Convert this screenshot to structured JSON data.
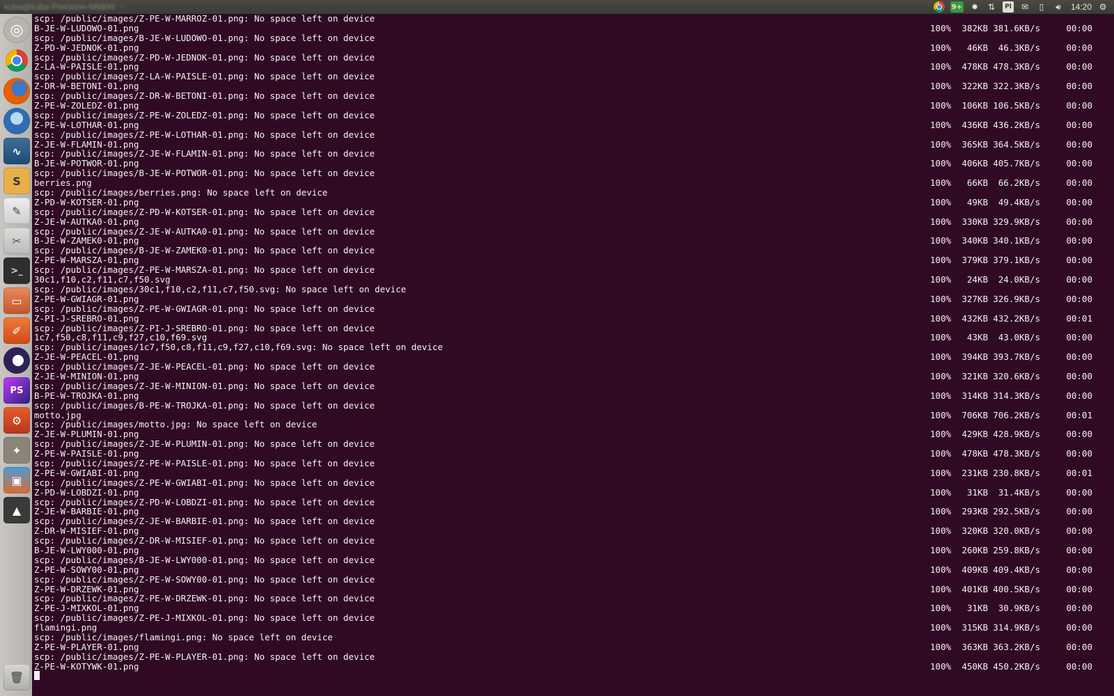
{
  "top_panel": {
    "window_title": "kuba@kuba-Precision-M6800: ~",
    "tray_icons": [
      "chrome-icon",
      "updates-badge-icon",
      "settings-icon",
      "network-icon",
      "keyboard-layout-icon",
      "mail-icon",
      "battery-icon",
      "volume-icon",
      "system-gear-icon"
    ],
    "updates_badge": "9+",
    "keyboard_layout": "Pl",
    "clock": "14:20"
  },
  "launcher": {
    "items": [
      "ubuntu-dash-icon",
      "chrome-icon",
      "firefox-icon",
      "thunderbird-icon",
      "mysql-workbench-icon",
      "slack-icon",
      "text-editor-icon",
      "system-tools-icon",
      "terminal-icon",
      "files-icon",
      "pencil-icon",
      "eclipse-icon",
      "phpstorm-icon",
      "settings-icon",
      "gimp-icon",
      "package-icon",
      "inkscape-icon",
      "trash-icon"
    ]
  },
  "terminal": {
    "rows": [
      {
        "text": "scp: /public/images/Z-PE-W-MARROZ-01.png: No space left on device"
      },
      {
        "text": "B-JE-W-LUDOWO-01.png",
        "pct": "100%",
        "size": "382KB",
        "rate": "381.6KB/s",
        "time": "00:00"
      },
      {
        "text": "scp: /public/images/B-JE-W-LUDOWO-01.png: No space left on device"
      },
      {
        "text": "Z-PD-W-JEDNOK-01.png",
        "pct": "100%",
        "size": "46KB",
        "rate": "46.3KB/s",
        "time": "00:00"
      },
      {
        "text": "scp: /public/images/Z-PD-W-JEDNOK-01.png: No space left on device"
      },
      {
        "text": "Z-LA-W-PAISLE-01.png",
        "pct": "100%",
        "size": "478KB",
        "rate": "478.3KB/s",
        "time": "00:00"
      },
      {
        "text": "scp: /public/images/Z-LA-W-PAISLE-01.png: No space left on device"
      },
      {
        "text": "Z-DR-W-BETONI-01.png",
        "pct": "100%",
        "size": "322KB",
        "rate": "322.3KB/s",
        "time": "00:00"
      },
      {
        "text": "scp: /public/images/Z-DR-W-BETONI-01.png: No space left on device"
      },
      {
        "text": "Z-PE-W-ZOLEDZ-01.png",
        "pct": "100%",
        "size": "106KB",
        "rate": "106.5KB/s",
        "time": "00:00"
      },
      {
        "text": "scp: /public/images/Z-PE-W-ZOLEDZ-01.png: No space left on device"
      },
      {
        "text": "Z-PE-W-LOTHAR-01.png",
        "pct": "100%",
        "size": "436KB",
        "rate": "436.2KB/s",
        "time": "00:00"
      },
      {
        "text": "scp: /public/images/Z-PE-W-LOTHAR-01.png: No space left on device"
      },
      {
        "text": "Z-JE-W-FLAMIN-01.png",
        "pct": "100%",
        "size": "365KB",
        "rate": "364.5KB/s",
        "time": "00:00"
      },
      {
        "text": "scp: /public/images/Z-JE-W-FLAMIN-01.png: No space left on device"
      },
      {
        "text": "B-JE-W-POTWOR-01.png",
        "pct": "100%",
        "size": "406KB",
        "rate": "405.7KB/s",
        "time": "00:00"
      },
      {
        "text": "scp: /public/images/B-JE-W-POTWOR-01.png: No space left on device"
      },
      {
        "text": "berries.png",
        "pct": "100%",
        "size": "66KB",
        "rate": "66.2KB/s",
        "time": "00:00"
      },
      {
        "text": "scp: /public/images/berries.png: No space left on device"
      },
      {
        "text": "Z-PD-W-KOTSER-01.png",
        "pct": "100%",
        "size": "49KB",
        "rate": "49.4KB/s",
        "time": "00:00"
      },
      {
        "text": "scp: /public/images/Z-PD-W-KOTSER-01.png: No space left on device"
      },
      {
        "text": "Z-JE-W-AUTKA0-01.png",
        "pct": "100%",
        "size": "330KB",
        "rate": "329.9KB/s",
        "time": "00:00"
      },
      {
        "text": "scp: /public/images/Z-JE-W-AUTKA0-01.png: No space left on device"
      },
      {
        "text": "B-JE-W-ZAMEK0-01.png",
        "pct": "100%",
        "size": "340KB",
        "rate": "340.1KB/s",
        "time": "00:00"
      },
      {
        "text": "scp: /public/images/B-JE-W-ZAMEK0-01.png: No space left on device"
      },
      {
        "text": "Z-PE-W-MARSZA-01.png",
        "pct": "100%",
        "size": "379KB",
        "rate": "379.1KB/s",
        "time": "00:00"
      },
      {
        "text": "scp: /public/images/Z-PE-W-MARSZA-01.png: No space left on device"
      },
      {
        "text": "30c1,f10,c2,f11,c7,f50.svg",
        "pct": "100%",
        "size": "24KB",
        "rate": "24.0KB/s",
        "time": "00:00"
      },
      {
        "text": "scp: /public/images/30c1,f10,c2,f11,c7,f50.svg: No space left on device"
      },
      {
        "text": "Z-PE-W-GWIAGR-01.png",
        "pct": "100%",
        "size": "327KB",
        "rate": "326.9KB/s",
        "time": "00:00"
      },
      {
        "text": "scp: /public/images/Z-PE-W-GWIAGR-01.png: No space left on device"
      },
      {
        "text": "Z-PI-J-SREBRO-01.png",
        "pct": "100%",
        "size": "432KB",
        "rate": "432.2KB/s",
        "time": "00:01"
      },
      {
        "text": "scp: /public/images/Z-PI-J-SREBRO-01.png: No space left on device"
      },
      {
        "text": "1c7,f50,c8,f11,c9,f27,c10,f69.svg",
        "pct": "100%",
        "size": "43KB",
        "rate": "43.0KB/s",
        "time": "00:00"
      },
      {
        "text": "scp: /public/images/1c7,f50,c8,f11,c9,f27,c10,f69.svg: No space left on device"
      },
      {
        "text": "Z-JE-W-PEACEL-01.png",
        "pct": "100%",
        "size": "394KB",
        "rate": "393.7KB/s",
        "time": "00:00"
      },
      {
        "text": "scp: /public/images/Z-JE-W-PEACEL-01.png: No space left on device"
      },
      {
        "text": "Z-JE-W-MINION-01.png",
        "pct": "100%",
        "size": "321KB",
        "rate": "320.6KB/s",
        "time": "00:00"
      },
      {
        "text": "scp: /public/images/Z-JE-W-MINION-01.png: No space left on device"
      },
      {
        "text": "B-PE-W-TROJKA-01.png",
        "pct": "100%",
        "size": "314KB",
        "rate": "314.3KB/s",
        "time": "00:00"
      },
      {
        "text": "scp: /public/images/B-PE-W-TROJKA-01.png: No space left on device"
      },
      {
        "text": "motto.jpg",
        "pct": "100%",
        "size": "706KB",
        "rate": "706.2KB/s",
        "time": "00:01"
      },
      {
        "text": "scp: /public/images/motto.jpg: No space left on device"
      },
      {
        "text": "Z-JE-W-PLUMIN-01.png",
        "pct": "100%",
        "size": "429KB",
        "rate": "428.9KB/s",
        "time": "00:00"
      },
      {
        "text": "scp: /public/images/Z-JE-W-PLUMIN-01.png: No space left on device"
      },
      {
        "text": "Z-PE-W-PAISLE-01.png",
        "pct": "100%",
        "size": "478KB",
        "rate": "478.3KB/s",
        "time": "00:00"
      },
      {
        "text": "scp: /public/images/Z-PE-W-PAISLE-01.png: No space left on device"
      },
      {
        "text": "Z-PE-W-GWIABI-01.png",
        "pct": "100%",
        "size": "231KB",
        "rate": "230.8KB/s",
        "time": "00:01"
      },
      {
        "text": "scp: /public/images/Z-PE-W-GWIABI-01.png: No space left on device"
      },
      {
        "text": "Z-PD-W-LOBDZI-01.png",
        "pct": "100%",
        "size": "31KB",
        "rate": "31.4KB/s",
        "time": "00:00"
      },
      {
        "text": "scp: /public/images/Z-PD-W-LOBDZI-01.png: No space left on device"
      },
      {
        "text": "Z-JE-W-BARBIE-01.png",
        "pct": "100%",
        "size": "293KB",
        "rate": "292.5KB/s",
        "time": "00:00"
      },
      {
        "text": "scp: /public/images/Z-JE-W-BARBIE-01.png: No space left on device"
      },
      {
        "text": "Z-DR-W-MISIEF-01.png",
        "pct": "100%",
        "size": "320KB",
        "rate": "320.0KB/s",
        "time": "00:00"
      },
      {
        "text": "scp: /public/images/Z-DR-W-MISIEF-01.png: No space left on device"
      },
      {
        "text": "B-JE-W-LWY000-01.png",
        "pct": "100%",
        "size": "260KB",
        "rate": "259.8KB/s",
        "time": "00:00"
      },
      {
        "text": "scp: /public/images/B-JE-W-LWY000-01.png: No space left on device"
      },
      {
        "text": "Z-PE-W-SOWY00-01.png",
        "pct": "100%",
        "size": "409KB",
        "rate": "409.4KB/s",
        "time": "00:00"
      },
      {
        "text": "scp: /public/images/Z-PE-W-SOWY00-01.png: No space left on device"
      },
      {
        "text": "Z-PE-W-DRZEWK-01.png",
        "pct": "100%",
        "size": "401KB",
        "rate": "400.5KB/s",
        "time": "00:00"
      },
      {
        "text": "scp: /public/images/Z-PE-W-DRZEWK-01.png: No space left on device"
      },
      {
        "text": "Z-PE-J-MIXKOL-01.png",
        "pct": "100%",
        "size": "31KB",
        "rate": "30.9KB/s",
        "time": "00:00"
      },
      {
        "text": "scp: /public/images/Z-PE-J-MIXKOL-01.png: No space left on device"
      },
      {
        "text": "flamingi.png",
        "pct": "100%",
        "size": "315KB",
        "rate": "314.9KB/s",
        "time": "00:00"
      },
      {
        "text": "scp: /public/images/flamingi.png: No space left on device"
      },
      {
        "text": "Z-PE-W-PLAYER-01.png",
        "pct": "100%",
        "size": "363KB",
        "rate": "363.2KB/s",
        "time": "00:00"
      },
      {
        "text": "scp: /public/images/Z-PE-W-PLAYER-01.png: No space left on device"
      },
      {
        "text": "Z-PE-W-KOTYWK-01.png",
        "pct": "100%",
        "size": "450KB",
        "rate": "450.2KB/s",
        "time": "00:00"
      }
    ]
  }
}
